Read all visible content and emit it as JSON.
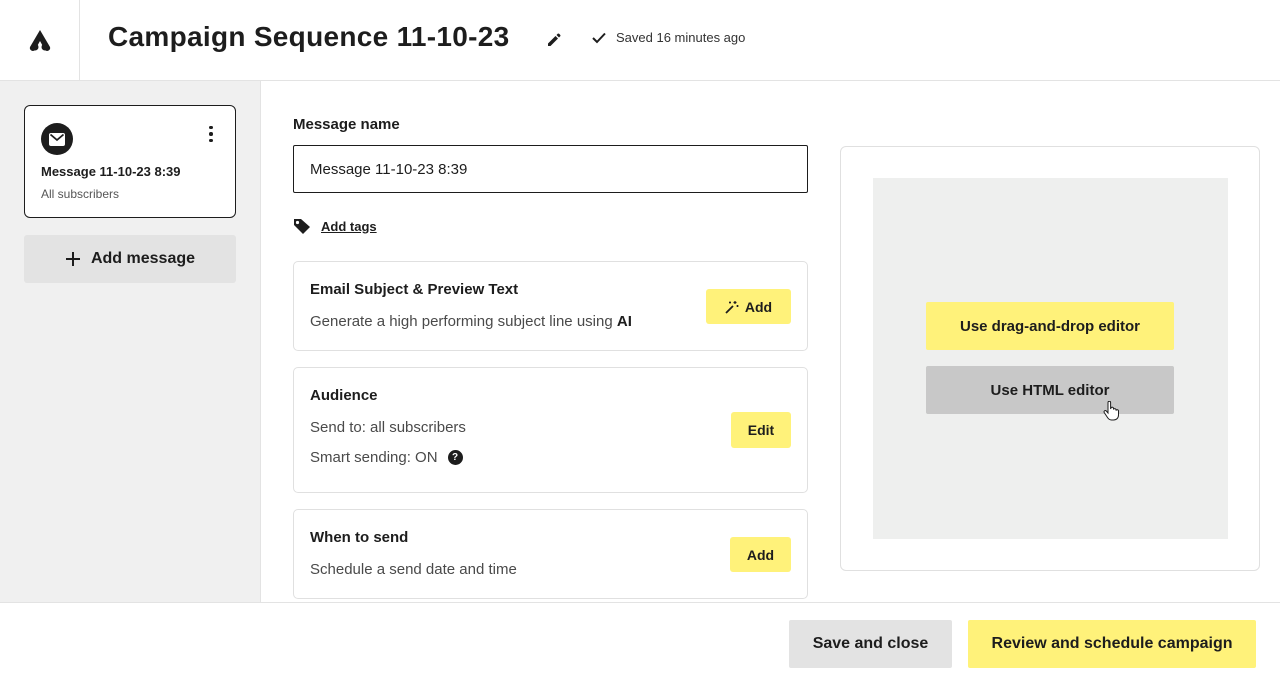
{
  "header": {
    "title": "Campaign Sequence 11-10-23",
    "saved_status": "Saved 16 minutes ago"
  },
  "sidebar": {
    "messages": [
      {
        "name": "Message 11-10-23 8:39",
        "audience": "All subscribers"
      }
    ],
    "add_message_label": "Add message"
  },
  "form": {
    "message_name_label": "Message name",
    "message_name_value": "Message 11-10-23 8:39",
    "add_tags_label": "Add tags"
  },
  "cards": {
    "subject": {
      "title": "Email Subject & Preview Text",
      "text": "Generate a high performing subject line using ",
      "text_strong": "AI",
      "button": "Add"
    },
    "audience": {
      "title": "Audience",
      "send_to": "Send to: all subscribers",
      "smart_sending": "Smart sending: ON",
      "button": "Edit"
    },
    "when": {
      "title": "When to send",
      "text": "Schedule a send date and time",
      "button": "Add"
    }
  },
  "preview": {
    "drag_drop_label": "Use drag-and-drop editor",
    "html_editor_label": "Use HTML editor"
  },
  "footer": {
    "save_close_label": "Save and close",
    "review_label": "Review and schedule campaign"
  },
  "colors": {
    "accent_yellow": "#fff27a",
    "dark": "#1d1d1d",
    "secondary_gray": "#e3e3e3"
  }
}
